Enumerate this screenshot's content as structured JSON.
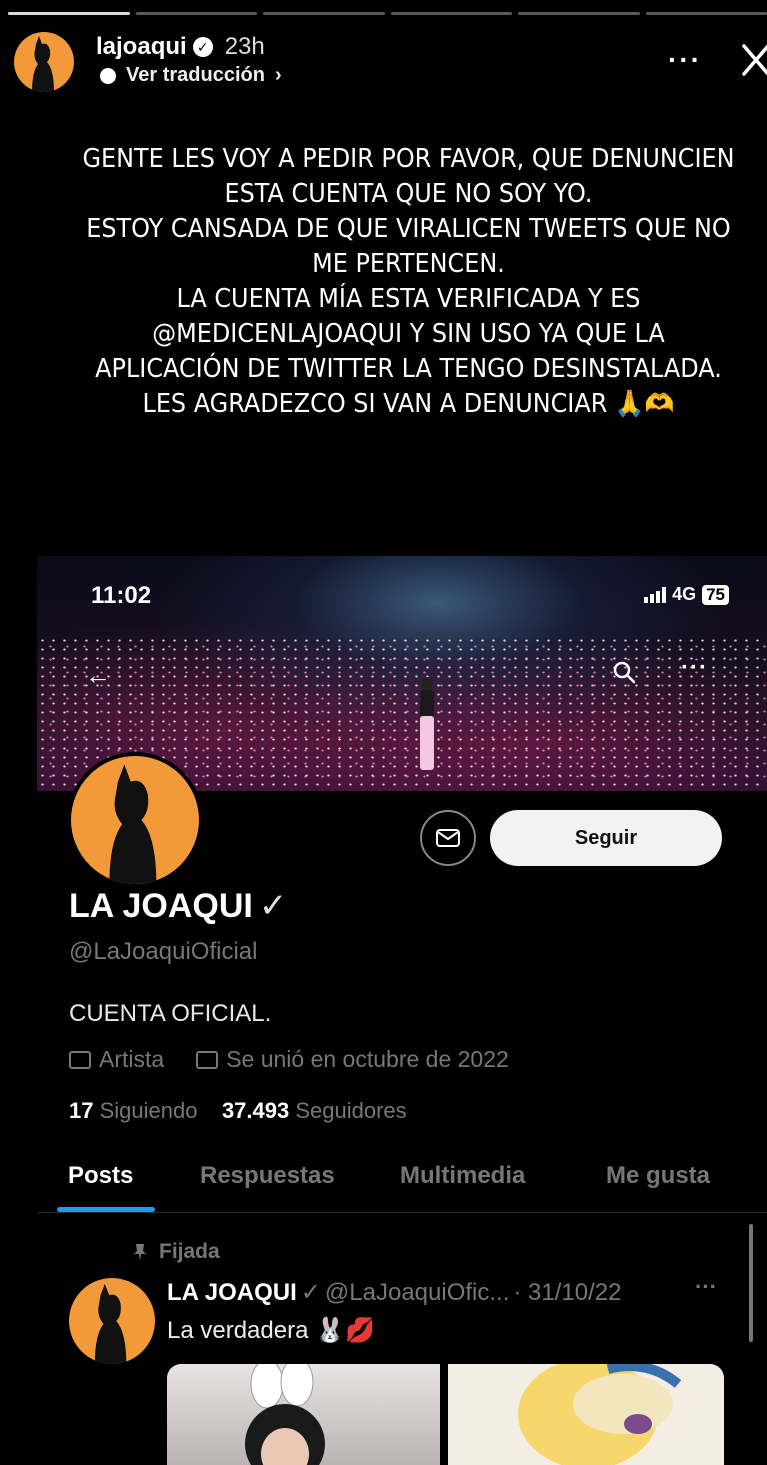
{
  "story": {
    "progress_segments": 6,
    "progress_done": 1,
    "username": "lajoaqui",
    "time": "23h",
    "translate_label": "Ver traducción",
    "text_lines": [
      "GENTE LES VOY A PEDIR POR FAVOR, QUE DENUNCIEN",
      "ESTA CUENTA QUE NO  SOY YO.",
      " ESTOY CANSADA DE QUE VIRALICEN TWEETS QUE NO",
      "ME PERTENCEN.",
      "LA CUENTA MÍA ESTA VERIFICADA Y ES",
      "@MEDICENLAJOAQUI Y SIN USO YA QUE LA",
      "APLICACIÓN DE TWITTER LA TENGO DESINSTALADA.",
      "LES AGRADEZCO SI VAN A DENUNCIAR 🙏🫶"
    ]
  },
  "screenshot": {
    "status_time": "11:02",
    "network": "4G",
    "battery": "75",
    "follow_label": "Seguir",
    "profile_name": "LA JOAQUI",
    "profile_check": "✓",
    "profile_handle": "@LaJoaquiOficial",
    "bio": "CUENTA OFICIAL.",
    "category": "Artista",
    "joined": "Se unió en octubre de 2022",
    "following_count": "17",
    "following_label": "Siguiendo",
    "followers_count": "37.493",
    "followers_label": "Seguidores",
    "tabs": [
      "Posts",
      "Respuestas",
      "Multimedia",
      "Me gusta"
    ],
    "pinned_label": "Fijada",
    "tweet": {
      "name": "LA JOAQUI",
      "check": "✓",
      "handle": "@LaJoaquiOfic...",
      "date": "· 31/10/22",
      "more": "···",
      "text": "La verdadera 🐰💋"
    }
  },
  "colors": {
    "avatar_orange": "#f29a3a",
    "tab_accent": "#1d9bf0"
  }
}
